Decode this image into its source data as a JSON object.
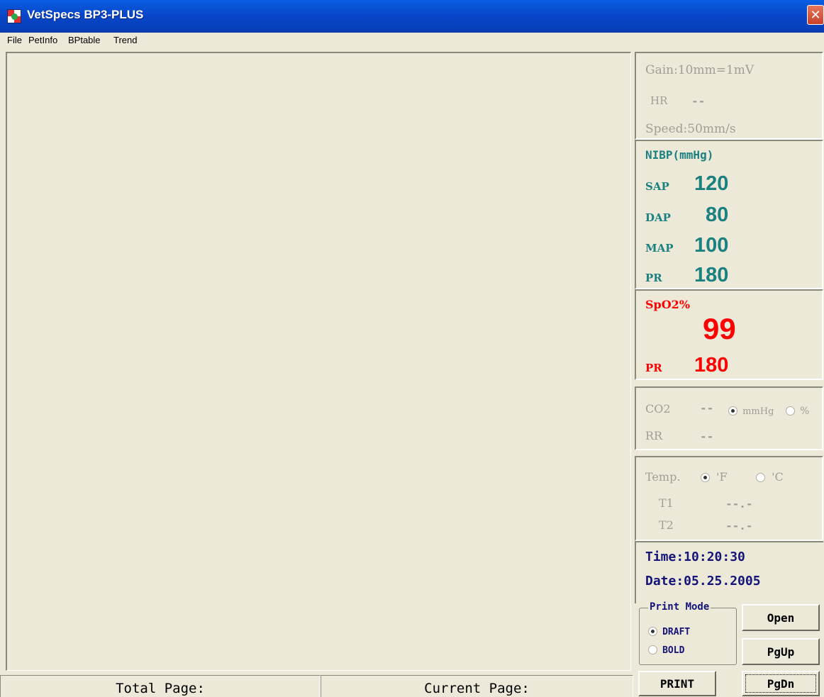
{
  "window": {
    "title": "VetSpecs  BP3-PLUS",
    "close_glyph": "✕"
  },
  "menu": {
    "items": [
      "File",
      "PetInfo",
      "BPtable",
      "Trend"
    ]
  },
  "status": {
    "total_page": "Total Page:",
    "current_page": "Current Page:"
  },
  "ecg": {
    "gain": "Gain:10mm=1mV",
    "hr_label": "HR",
    "hr_value": "--",
    "speed": "Speed:50mm/s"
  },
  "nibp": {
    "title": "NIBP(mmHg)",
    "sap_label": "SAP",
    "sap_value": "120",
    "dap_label": "DAP",
    "dap_value": "80",
    "map_label": "MAP",
    "map_value": "100",
    "pr_label": "PR",
    "pr_value": "180"
  },
  "spo2": {
    "title": "SpO2%",
    "value": "99",
    "pr_label": "PR",
    "pr_value": "180"
  },
  "co2": {
    "label": "CO2",
    "value": "--",
    "unit_mmhg": "mmHg",
    "unit_pct": "%",
    "selected_unit": "mmHg",
    "rr_label": "RR",
    "rr_value": "--"
  },
  "temp": {
    "label": "Temp.",
    "unit_f": "'F",
    "unit_c": "'C",
    "selected_unit": "'F",
    "t1_label": "T1",
    "t1_value": "--.-",
    "t2_label": "T2",
    "t2_value": "--.-"
  },
  "clock": {
    "time": "Time:10:20:30",
    "date": "Date:05.25.2005"
  },
  "print_mode": {
    "title": "Print Mode",
    "draft": "DRAFT",
    "bold": "BOLD",
    "selected": "DRAFT"
  },
  "buttons": {
    "open": "Open",
    "pgup": "PgUp",
    "pgdn": "PgDn",
    "print": "PRINT"
  },
  "colors": {
    "teal": "#1a8080",
    "red": "#ff0000",
    "navy": "#14147a",
    "gray": "#a09e96",
    "titlebar": "#0845c8"
  }
}
